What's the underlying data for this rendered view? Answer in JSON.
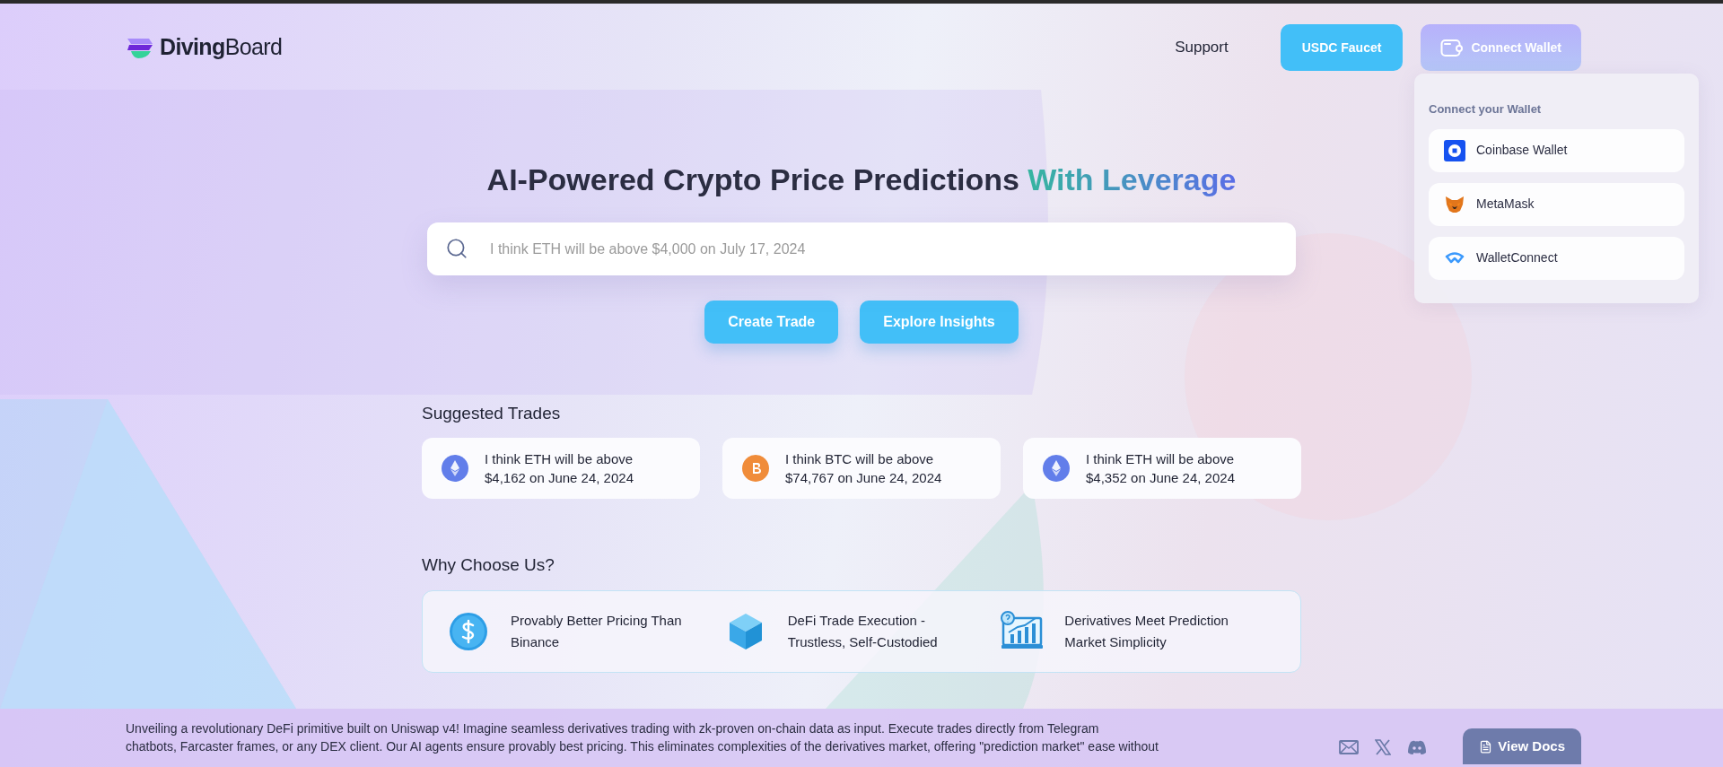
{
  "header": {
    "logo": {
      "bold": "Diving",
      "light": "Board"
    },
    "nav": [
      {
        "label": "Support"
      }
    ],
    "faucet_button": "USDC Faucet",
    "wallet_button": "Connect Wallet"
  },
  "wallet_menu": {
    "title": "Connect your Wallet",
    "items": [
      {
        "label": "Coinbase Wallet",
        "kind": "coinbase"
      },
      {
        "label": "MetaMask",
        "kind": "metamask"
      },
      {
        "label": "WalletConnect",
        "kind": "walletconnect"
      }
    ]
  },
  "hero": {
    "title": "AI-Powered Crypto Price Predictions",
    "title_accent": "With Leverage",
    "search": {
      "placeholder": "I think ETH will be above $4,000 on July 17, 2024"
    },
    "buttons": [
      "Create Trade",
      "Explore Insights"
    ]
  },
  "suggested": {
    "title": "Suggested Trades",
    "trades": [
      {
        "kind": "eth",
        "line1": "I think ETH will be above",
        "line2": "$4,162 on June 24, 2024"
      },
      {
        "kind": "btc",
        "line1": "I think BTC will be above",
        "line2": "$74,767 on June 24, 2024"
      },
      {
        "kind": "eth",
        "line1": "I think ETH will be above",
        "line2": "$4,352 on June 24, 2024"
      }
    ]
  },
  "why": {
    "title": "Why Choose Us?",
    "features": [
      {
        "kind": "dollar",
        "line1": "Provably Better Pricing Than",
        "line2": "Binance"
      },
      {
        "kind": "cube",
        "line1": "DeFi Trade Execution -",
        "line2": "Trustless, Self-Custodied"
      },
      {
        "kind": "chart",
        "line1": "Derivatives Meet Prediction",
        "line2": "Market Simplicity"
      }
    ]
  },
  "footer": {
    "lines": [
      "Unveiling a revolutionary DeFi primitive built on Uniswap v4! Imagine seamless derivatives trading with zk-proven on-chain data as input. Execute trades directly from Telegram",
      "chatbots, Farcaster frames, or any DEX client. Our AI agents ensure provably best pricing. This eliminates complexities of the derivatives market, offering \"prediction market\" ease without"
    ],
    "social": [
      {
        "kind": "mail"
      },
      {
        "kind": "x"
      },
      {
        "kind": "discord"
      }
    ],
    "docs_button": "View Docs"
  }
}
